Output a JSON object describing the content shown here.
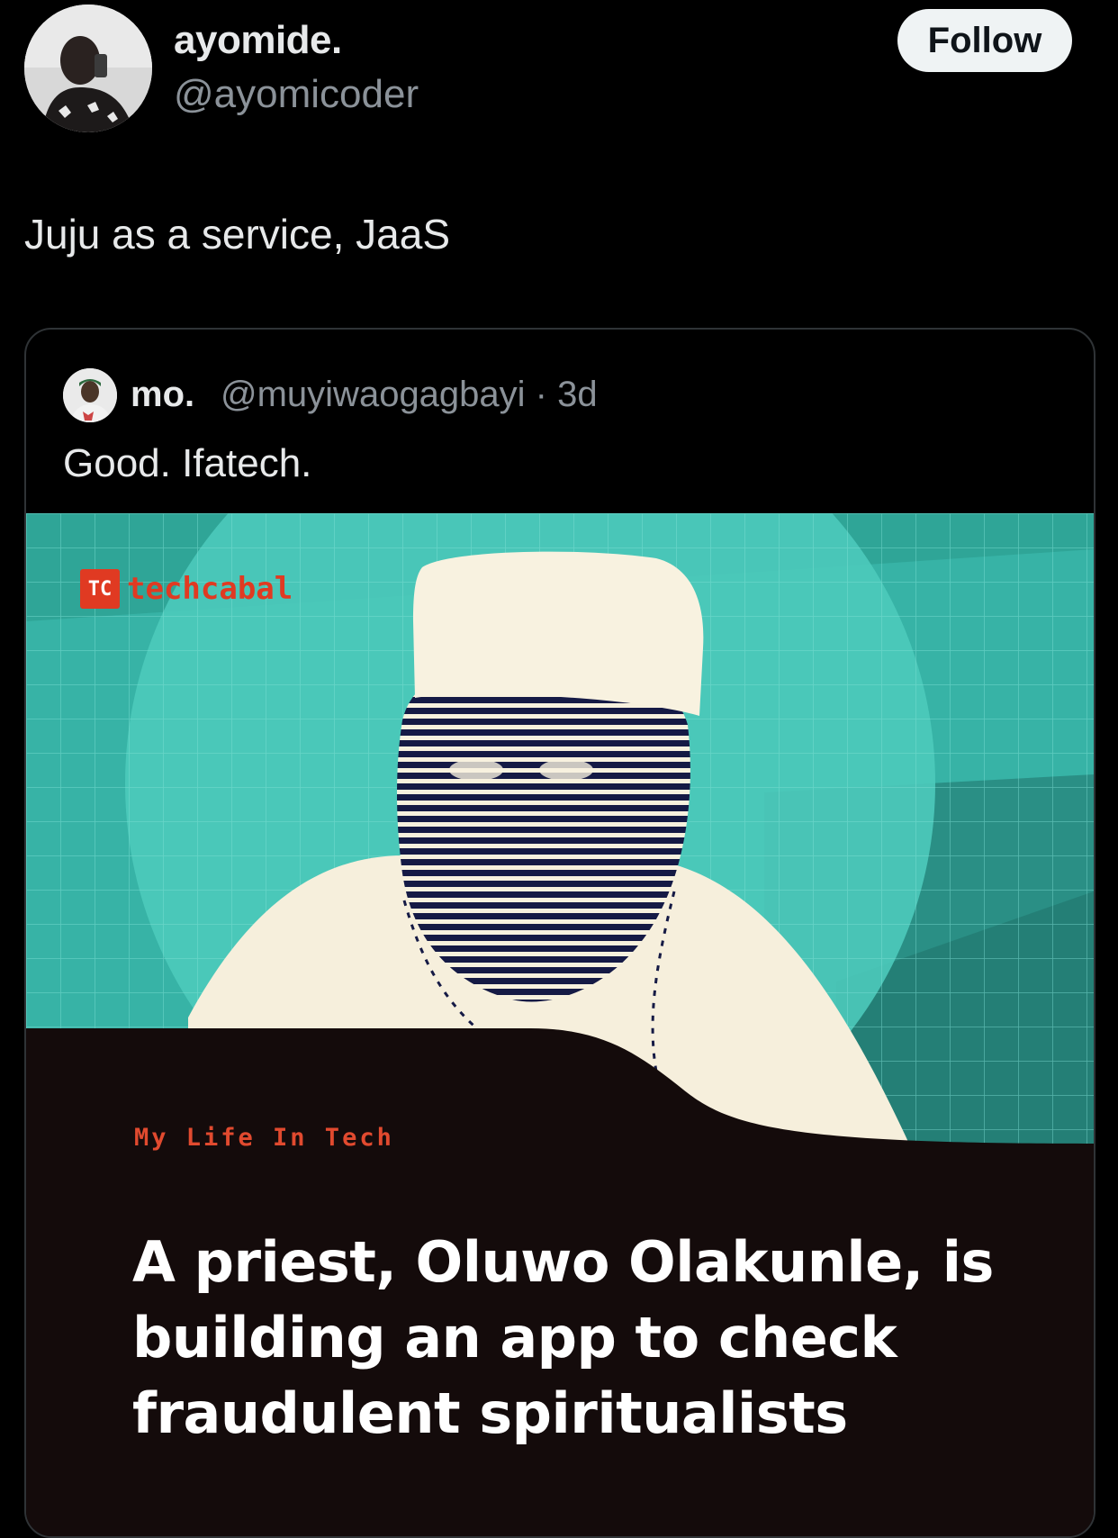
{
  "author": {
    "name": "ayomide.",
    "handle": "@ayomicoder",
    "avatar_icon": "user-avatar-photo"
  },
  "follow_button": {
    "label": "Follow"
  },
  "tweet": {
    "text": "Juju as a service, JaaS"
  },
  "quoted_tweet": {
    "name": "mo.",
    "handle_time": "@muyiwaogagbayi · 3d",
    "text": "Good. Ifatech.",
    "avatar_icon": "user-avatar-photo",
    "image": {
      "brand_mark": "TC",
      "brand_name": "techcabal",
      "category": "My Life In Tech",
      "headline": "A priest, Oluwo Olakunle, is building an app to check fraudulent spiritualists",
      "colors": {
        "teal": "#3fbfb0",
        "teal_dark": "#2a8f85",
        "dark_panel": "#140b0b",
        "accent": "#e03a22"
      }
    }
  },
  "colors": {
    "background": "#000000",
    "text_primary": "#e7e9ea",
    "text_secondary": "#8b9299",
    "border": "#2f3336"
  }
}
